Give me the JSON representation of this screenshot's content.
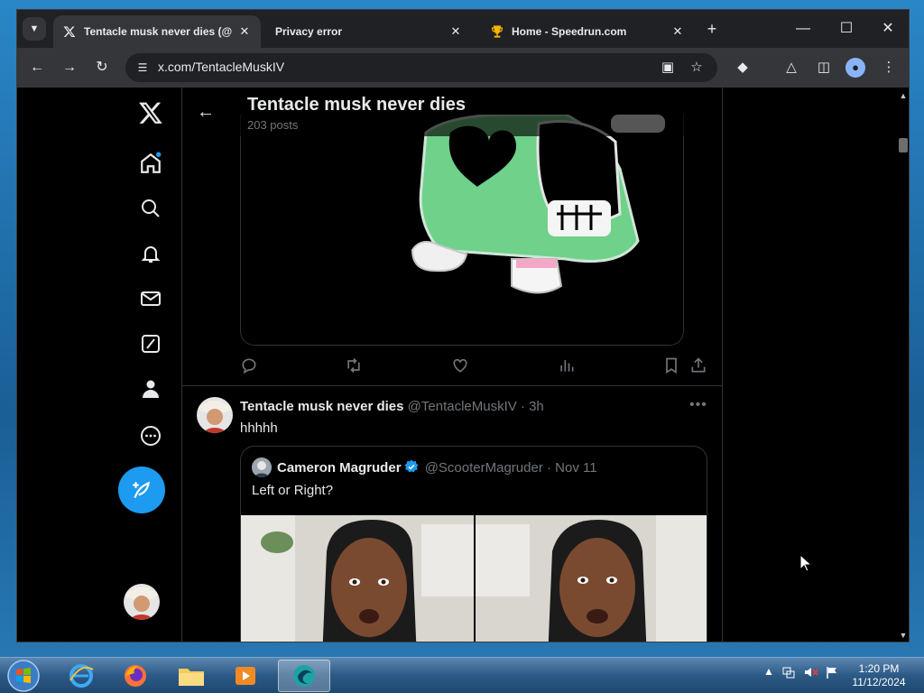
{
  "browser": {
    "tabs": [
      {
        "title": "Tentacle musk never dies (@Te",
        "favicon": "x-logo-icon",
        "active": true
      },
      {
        "title": "Privacy error",
        "favicon": "",
        "active": false
      },
      {
        "title": "Home - Speedrun.com",
        "favicon": "trophy-icon",
        "active": false
      }
    ],
    "url": "x.com/TentacleMuskIV"
  },
  "header": {
    "name": "Tentacle musk never dies",
    "posts_count": "203 posts"
  },
  "post": {
    "author_name": "Tentacle musk never dies",
    "author_meta": "@TentacleMuskIV · 3h",
    "text": "hhhhh"
  },
  "quote": {
    "author_name": "Cameron Magruder",
    "author_meta": "@ScooterMagruder · Nov 11",
    "text": "Left or Right?"
  },
  "taskbar": {
    "time": "1:20 PM",
    "date": "11/12/2024"
  },
  "colors": {
    "accent": "#1d9bf0",
    "background": "#000000",
    "text": "#e7e9ea",
    "muted": "#71767b"
  }
}
